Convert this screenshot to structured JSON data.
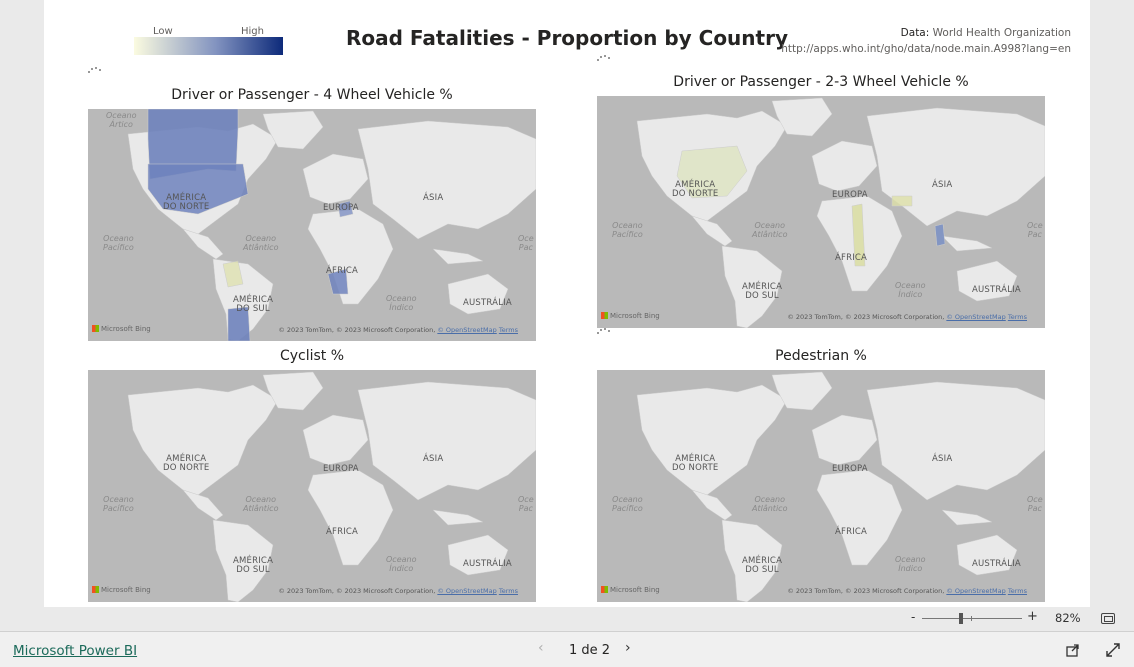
{
  "report": {
    "title": "Road Fatalities - Proportion by Country",
    "legend": {
      "low": "Low",
      "high": "High"
    },
    "source": {
      "label": "Data:",
      "org": "World Health Organization",
      "url": "http://apps.who.int/gho/data/node.main.A998?lang=en"
    }
  },
  "maps": [
    {
      "title": "Driver or Passenger - 4 Wheel Vehicle %"
    },
    {
      "title": "Driver or Passenger - 2-3 Wheel Vehicle %"
    },
    {
      "title": "Cyclist %"
    },
    {
      "title": "Pedestrian %"
    }
  ],
  "map_labels": {
    "continents": {
      "north_america": "AMÉRICA\nDO NORTE",
      "europe": "EUROPA",
      "asia": "ÁSIA",
      "africa": "ÁFRICA",
      "south_america": "AMÉRICA\nDO SUL",
      "australia": "AUSTRÁLIA"
    },
    "oceans": {
      "arctic": "Oceano\nÁrtico",
      "pacific": "Oceano\nPacífico",
      "atlantic": "Oceano\nAtlântico",
      "indian": "Oceano\nÍndico",
      "pacific_short": "Oce\nPac"
    },
    "bing": "Microsoft Bing",
    "copyright": "© 2023 TomTom, © 2023 Microsoft Corporation,",
    "osm": "© OpenStreetMap",
    "terms": "Terms"
  },
  "zoom": {
    "minus": "-",
    "plus": "+",
    "percent": "82%",
    "level": 0.82
  },
  "footer": {
    "brand_link": "Microsoft Power BI",
    "page": "1 de 2",
    "prev": "‹",
    "next": "›"
  },
  "colors": {
    "low": "#fbfbe0",
    "mid": "#8293c0",
    "high": "#0d2a7a",
    "land": "#e9e9e9",
    "water": "#b9b9b9"
  }
}
